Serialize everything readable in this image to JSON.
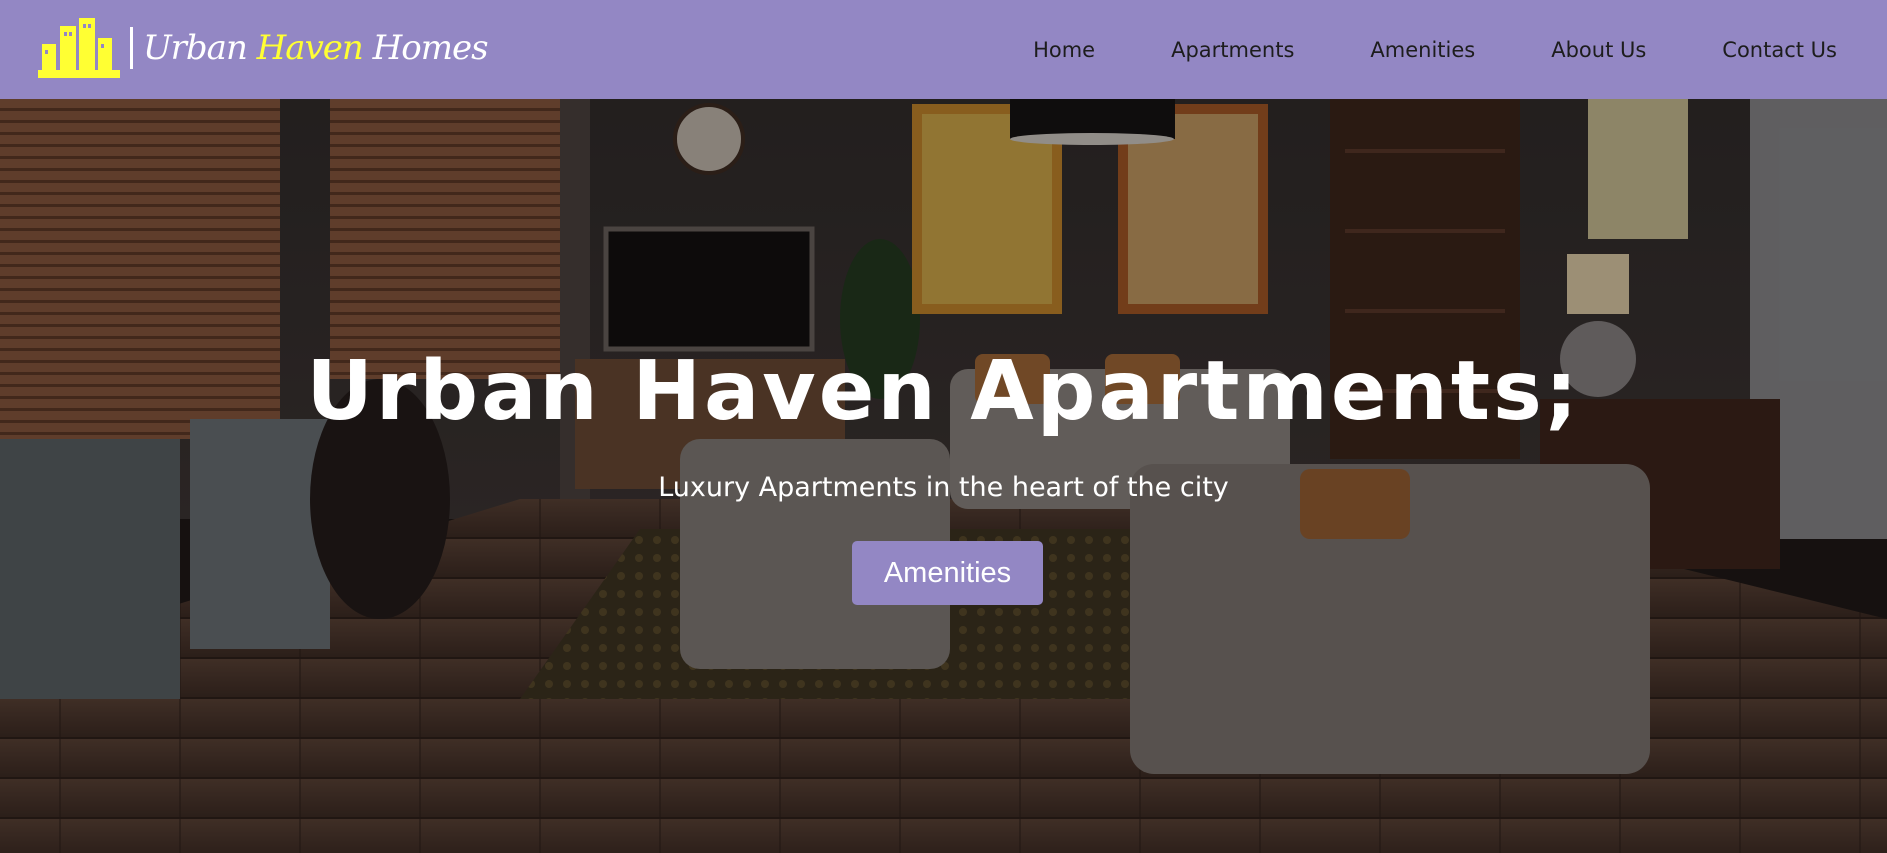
{
  "brand": {
    "name_part1": "Urban ",
    "name_highlight": "Haven",
    "name_part2": " Homes",
    "icon": "city-buildings-icon",
    "icon_color": "#ffff33",
    "highlight_color": "#ffff33"
  },
  "nav": {
    "background": "#9387c4",
    "items": [
      {
        "label": "Home"
      },
      {
        "label": "Apartments"
      },
      {
        "label": "Amenities"
      },
      {
        "label": "About Us"
      },
      {
        "label": "Contact Us"
      }
    ]
  },
  "hero": {
    "title": "Urban Haven Apartments;",
    "subtitle": "Luxury Apartments in the heart of the city",
    "button_label": "Amenities",
    "button_color": "#9387c4",
    "background": "living-room-photo"
  }
}
